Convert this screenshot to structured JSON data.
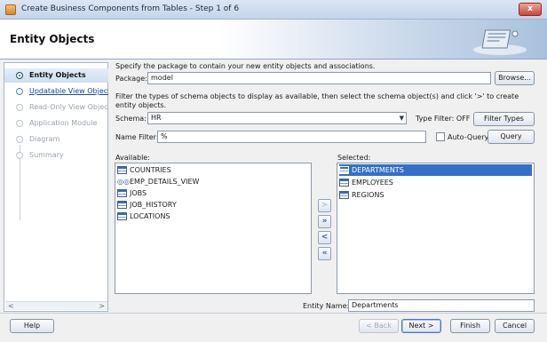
{
  "window": {
    "title": "Create Business Components from Tables - Step 1 of 6",
    "close": "x"
  },
  "header": {
    "page_title": "Entity Objects"
  },
  "nav": {
    "items": [
      {
        "label": "Entity Objects",
        "state": "active"
      },
      {
        "label": "Updatable View Objects",
        "state": "link"
      },
      {
        "label": "Read-Only View Objects",
        "state": "disabled"
      },
      {
        "label": "Application Module",
        "state": "disabled"
      },
      {
        "label": "Diagram",
        "state": "disabled"
      },
      {
        "label": "Summary",
        "state": "disabled"
      }
    ],
    "scroll_left": "<",
    "scroll_right": ">"
  },
  "main": {
    "package_intro": "Specify the package to contain your new entity objects and associations.",
    "package_label": "Package:",
    "package_value": "model",
    "browse_label": "Browse...",
    "filter_intro": "Filter the types of schema objects to display as available, then select the schema object(s) and click '>' to create entity objects.",
    "schema_label": "Schema:",
    "schema_value": "HR",
    "type_filter_label": "Type Filter: OFF",
    "filter_types_label": "Filter Types",
    "name_filter_label": "Name Filter:",
    "name_filter_value": "%",
    "auto_query_label": "Auto-Query",
    "auto_query_checked": false,
    "query_label": "Query",
    "available_label": "Available:",
    "available": [
      {
        "name": "COUNTRIES",
        "icon": "table-icon"
      },
      {
        "name": "EMP_DETAILS_VIEW",
        "icon": "view-icon"
      },
      {
        "name": "JOBS",
        "icon": "table-icon"
      },
      {
        "name": "JOB_HISTORY",
        "icon": "table-icon"
      },
      {
        "name": "LOCATIONS",
        "icon": "table-icon"
      }
    ],
    "selected_label": "Selected:",
    "selected": [
      {
        "name": "DEPARTMENTS",
        "icon": "table-icon",
        "highlighted": true
      },
      {
        "name": "EMPLOYEES",
        "icon": "table-icon"
      },
      {
        "name": "REGIONS",
        "icon": "table-icon"
      }
    ],
    "shuttle": {
      "add": ">",
      "add_all": "»",
      "remove": "<",
      "remove_all": "«"
    },
    "entity_name_label": "Entity Name:",
    "entity_name_value": "Departments"
  },
  "footer": {
    "help": "Help",
    "back": "< Back",
    "next": "Next >",
    "finish": "Finish",
    "cancel": "Cancel"
  },
  "colors": {
    "accent": "#3470c7",
    "header_gradient_end": "#a9c1dd"
  }
}
